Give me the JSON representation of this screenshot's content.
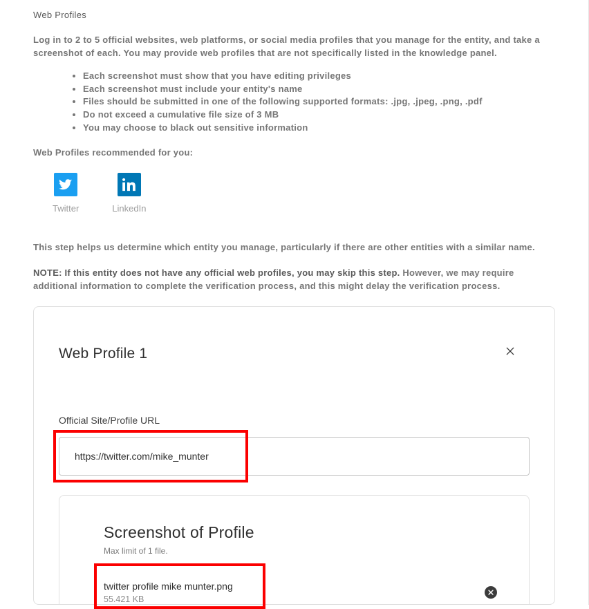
{
  "section_title": "Web Profiles",
  "intro": "Log in to 2 to 5 official websites, web platforms, or social media profiles that you manage for the entity, and take a screenshot of each. You may provide web profiles that are not specifically listed in the knowledge panel.",
  "requirements": [
    "Each screenshot must show that you have editing privileges",
    "Each screenshot must include your entity's name",
    "Files should be submitted in one of the following supported formats: .jpg, .jpeg, .png, .pdf",
    "Do not exceed a cumulative file size of 3 MB",
    "You may choose to black out sensitive information"
  ],
  "recommended_label": "Web Profiles recommended for you:",
  "recommended": [
    {
      "id": "twitter",
      "label": "Twitter"
    },
    {
      "id": "linkedin",
      "label": "LinkedIn"
    }
  ],
  "helper_text": "This step helps us determine which entity you manage, particularly if there are other entities with a similar name.",
  "note_bold": "NOTE: If this entity does not have any official web profiles, you may skip this step.",
  "note_rest": " However, we may require additional information to complete the verification process, and this might delay the verification process.",
  "card": {
    "title": "Web Profile 1",
    "url_label": "Official Site/Profile URL",
    "url_value": "https://twitter.com/mike_munter",
    "screenshot_title": "Screenshot of Profile",
    "limit_text": "Max limit of 1 file.",
    "file_name": "twitter profile mike munter.png",
    "file_size": "55.421 KB"
  }
}
